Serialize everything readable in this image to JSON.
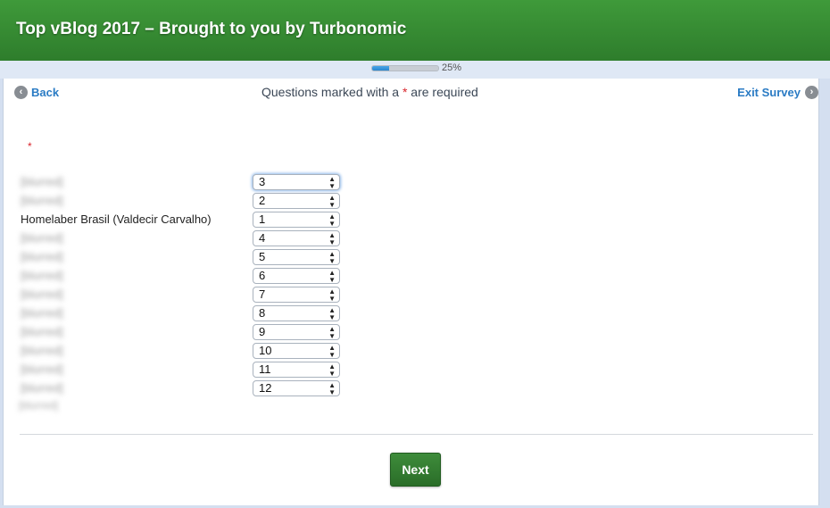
{
  "header": {
    "title": "Top vBlog 2017 – Brought to you by Turbonomic"
  },
  "progress": {
    "percent": 25,
    "label": "25%"
  },
  "nav": {
    "back_label": "Back",
    "back_icon": "chevron-left-icon",
    "exit_label": "Exit Survey",
    "exit_icon": "chevron-right-icon"
  },
  "required_note": {
    "prefix": "Questions marked with a ",
    "star": "*",
    "suffix": " are required"
  },
  "question": {
    "star": "*"
  },
  "ranking": {
    "rows": [
      {
        "label": "[blurred]",
        "value": "3"
      },
      {
        "label": "[blurred]",
        "value": "2"
      },
      {
        "label": "Homelaber Brasil (Valdecir Carvalho)",
        "value": "1"
      },
      {
        "label": "[blurred]",
        "value": "4"
      },
      {
        "label": "[blurred]",
        "value": "5"
      },
      {
        "label": "[blurred]",
        "value": "6"
      },
      {
        "label": "[blurred]",
        "value": "7"
      },
      {
        "label": "[blurred]",
        "value": "8"
      },
      {
        "label": "[blurred]",
        "value": "9"
      },
      {
        "label": "[blurred]",
        "value": "10"
      },
      {
        "label": "[blurred]",
        "value": "11"
      },
      {
        "label": "[blurred]",
        "value": "12"
      }
    ]
  },
  "footnote": "[blurred]",
  "next_label": "Next",
  "colors": {
    "header_green": "#3f9a3a",
    "link_blue": "#2a7bc4",
    "required_red": "#d9252c"
  }
}
